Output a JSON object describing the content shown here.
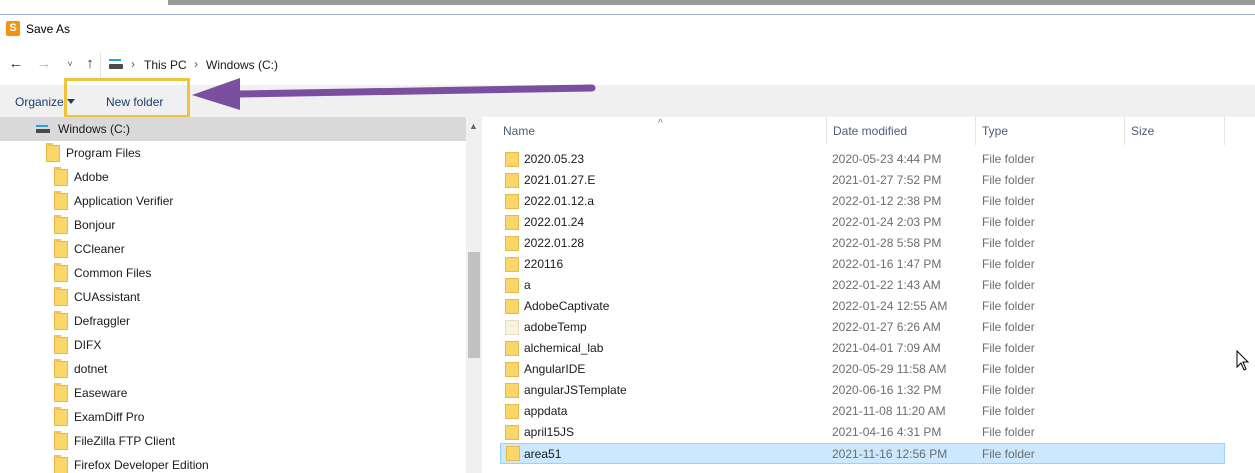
{
  "window": {
    "title": "Save As",
    "app_icon_letter": "S",
    "app_icon_color": "#f29317"
  },
  "nav": {
    "back": "←",
    "forward": "→",
    "recent": "˅",
    "up": "↑"
  },
  "breadcrumb": {
    "sep": "›",
    "items": [
      "This PC",
      "Windows (C:)"
    ]
  },
  "toolbar": {
    "organize": "Organize",
    "new_folder": "New folder"
  },
  "annotation": {
    "highlight_color": "#efc33c",
    "arrow_color": "#7b4fa0"
  },
  "tree": {
    "root": "Windows (C:)",
    "items": [
      "Program Files",
      "Adobe",
      "Application Verifier",
      "Bonjour",
      "CCleaner",
      "Common Files",
      "CUAssistant",
      "Defraggler",
      "DIFX",
      "dotnet",
      "Easeware",
      "ExamDiff Pro",
      "FileZilla FTP Client",
      "Firefox Developer Edition"
    ]
  },
  "columns": {
    "name": "Name",
    "date": "Date modified",
    "type": "Type",
    "size": "Size"
  },
  "files": [
    {
      "name": "2020.05.23",
      "date": "2020-05-23 4:44 PM",
      "type": "File folder"
    },
    {
      "name": "2021.01.27.E",
      "date": "2021-01-27 7:52 PM",
      "type": "File folder"
    },
    {
      "name": "2022.01.12.a",
      "date": "2022-01-12 2:38 PM",
      "type": "File folder"
    },
    {
      "name": "2022.01.24",
      "date": "2022-01-24 2:03 PM",
      "type": "File folder"
    },
    {
      "name": "2022.01.28",
      "date": "2022-01-28 5:58 PM",
      "type": "File folder"
    },
    {
      "name": "220116",
      "date": "2022-01-16 1:47 PM",
      "type": "File folder"
    },
    {
      "name": "a",
      "date": "2022-01-22 1:43 AM",
      "type": "File folder"
    },
    {
      "name": "AdobeCaptivate",
      "date": "2022-01-24 12:55 AM",
      "type": "File folder"
    },
    {
      "name": "adobeTemp",
      "date": "2022-01-27 6:26 AM",
      "type": "File folder"
    },
    {
      "name": "alchemical_lab",
      "date": "2021-04-01 7:09 AM",
      "type": "File folder"
    },
    {
      "name": "AngularIDE",
      "date": "2020-05-29 11:58 AM",
      "type": "File folder"
    },
    {
      "name": "angularJSTemplate",
      "date": "2020-06-16 1:32 PM",
      "type": "File folder"
    },
    {
      "name": "appdata",
      "date": "2021-11-08 11:20 AM",
      "type": "File folder"
    },
    {
      "name": "april15JS",
      "date": "2021-04-16 4:31 PM",
      "type": "File folder"
    },
    {
      "name": "area51",
      "date": "2021-11-16 12:56 PM",
      "type": "File folder"
    }
  ],
  "selected_file": "area51"
}
